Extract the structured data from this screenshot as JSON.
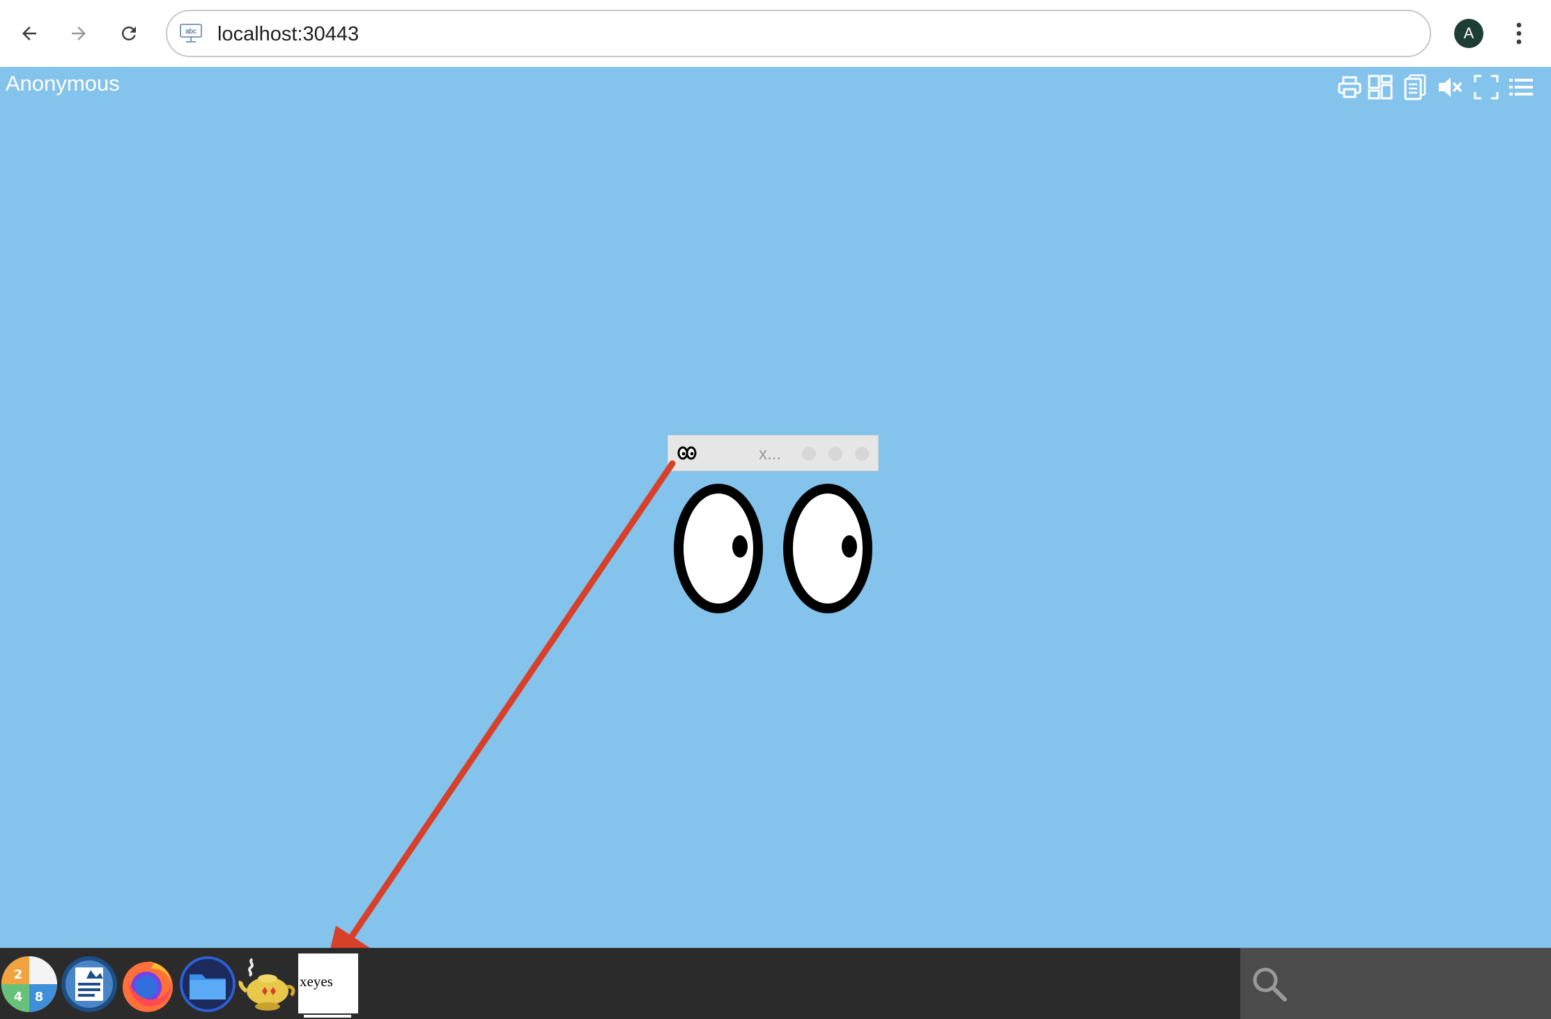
{
  "browser": {
    "url": "localhost:30443",
    "site_icon_text": "abc",
    "profile_initial": "A",
    "icons": [
      "back-icon",
      "forward-icon",
      "reload-icon",
      "site-info-icon",
      "kebab-menu-icon"
    ]
  },
  "desktop": {
    "user_label": "Anonymous",
    "background_color": "#84c3ec",
    "toolbar_icons": [
      "print-icon",
      "layout-icon",
      "clipboard-icon",
      "mute-icon",
      "fullscreen-icon",
      "menu-list-icon"
    ]
  },
  "xeyes_window": {
    "title": "x..."
  },
  "taskbar": {
    "launchers": [
      "calculator-icon",
      "document-viewer-icon",
      "firefox-icon",
      "file-manager-icon",
      "genie-lamp-icon"
    ],
    "task_label": "xeyes",
    "search_icon": "search-icon"
  },
  "colors": {
    "annotation_arrow": "#d8402a",
    "taskbar": "#2b2b2b",
    "search_box": "#4c4c4c"
  }
}
